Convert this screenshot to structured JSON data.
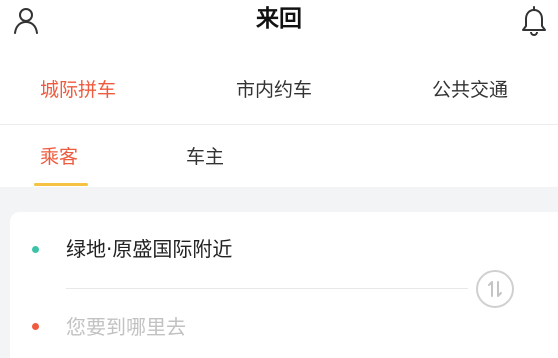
{
  "header": {
    "title": "来回",
    "left_icon": "user-icon",
    "right_icon": "bell-icon"
  },
  "main_tabs": [
    {
      "label": "城际拼车",
      "active": true
    },
    {
      "label": "市内约车",
      "active": false
    },
    {
      "label": "公共交通",
      "active": false
    }
  ],
  "sub_tabs": [
    {
      "label": "乘客",
      "active": true
    },
    {
      "label": "车主",
      "active": false
    }
  ],
  "route": {
    "from": "绿地·原盛国际附近",
    "to_placeholder": "您要到哪里去",
    "swap_icon": "swap-arrows-icon"
  },
  "colors": {
    "accent": "#ef5b3e",
    "underline": "#f6c244",
    "from_dot": "#3cc2a7",
    "to_dot": "#ef5b3e"
  }
}
